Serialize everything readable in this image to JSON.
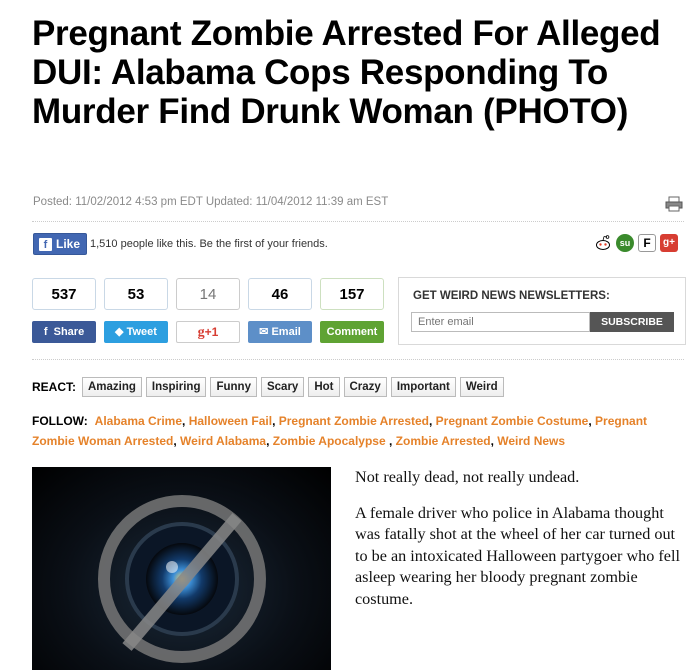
{
  "article": {
    "headline": "Pregnant Zombie Arrested For Alleged DUI: Alabama Cops Responding To Murder Find Drunk Woman (PHOTO)",
    "dateline": "Posted: 11/02/2012 4:53 pm EDT Updated: 11/04/2012 11:39 am EST",
    "body": [
      "Not really dead, not really undead.",
      "A female driver who police in Alabama thought was fatally shot at the wheel of her car turned out to be an intoxicated Halloween partygoer who fell asleep wearing her bloody pregnant zombie costume."
    ]
  },
  "facebook": {
    "like_label": "Like",
    "like_text": "1,510 people like this. Be the first of your friends."
  },
  "share": [
    {
      "count": "537",
      "label": "Share",
      "color": "#3b5998",
      "icon": "facebook-icon"
    },
    {
      "count": "53",
      "label": "Tweet",
      "color": "#2d9fe0",
      "icon": "twitter-icon"
    },
    {
      "count": "14",
      "label": "+1",
      "color": "#ffffff",
      "icon": "google-plus-icon"
    },
    {
      "count": "46",
      "label": "Email",
      "color": "#5d8fc8",
      "icon": "email-icon"
    },
    {
      "count": "157",
      "label": "Comment",
      "color": "#5fa333",
      "icon": "comment-icon"
    }
  ],
  "newsletter": {
    "title": "GET WEIRD NEWS NEWSLETTERS:",
    "placeholder": "Enter email",
    "button": "SUBSCRIBE"
  },
  "react": {
    "label": "REACT:",
    "options": [
      "Amazing",
      "Inspiring",
      "Funny",
      "Scary",
      "Hot",
      "Crazy",
      "Important",
      "Weird"
    ]
  },
  "follow": {
    "label": "FOLLOW:",
    "tags": [
      "Alabama Crime",
      "Halloween Fail",
      "Pregnant Zombie Arrested",
      "Pregnant Zombie Costume",
      "Pregnant Zombie Woman Arrested",
      "Weird Alabama",
      "Zombie Apocalypse ",
      "Zombie Arrested",
      "Weird News"
    ]
  },
  "colors": {
    "accent_orange": "#e5822a",
    "facebook_blue": "#4267b2"
  }
}
